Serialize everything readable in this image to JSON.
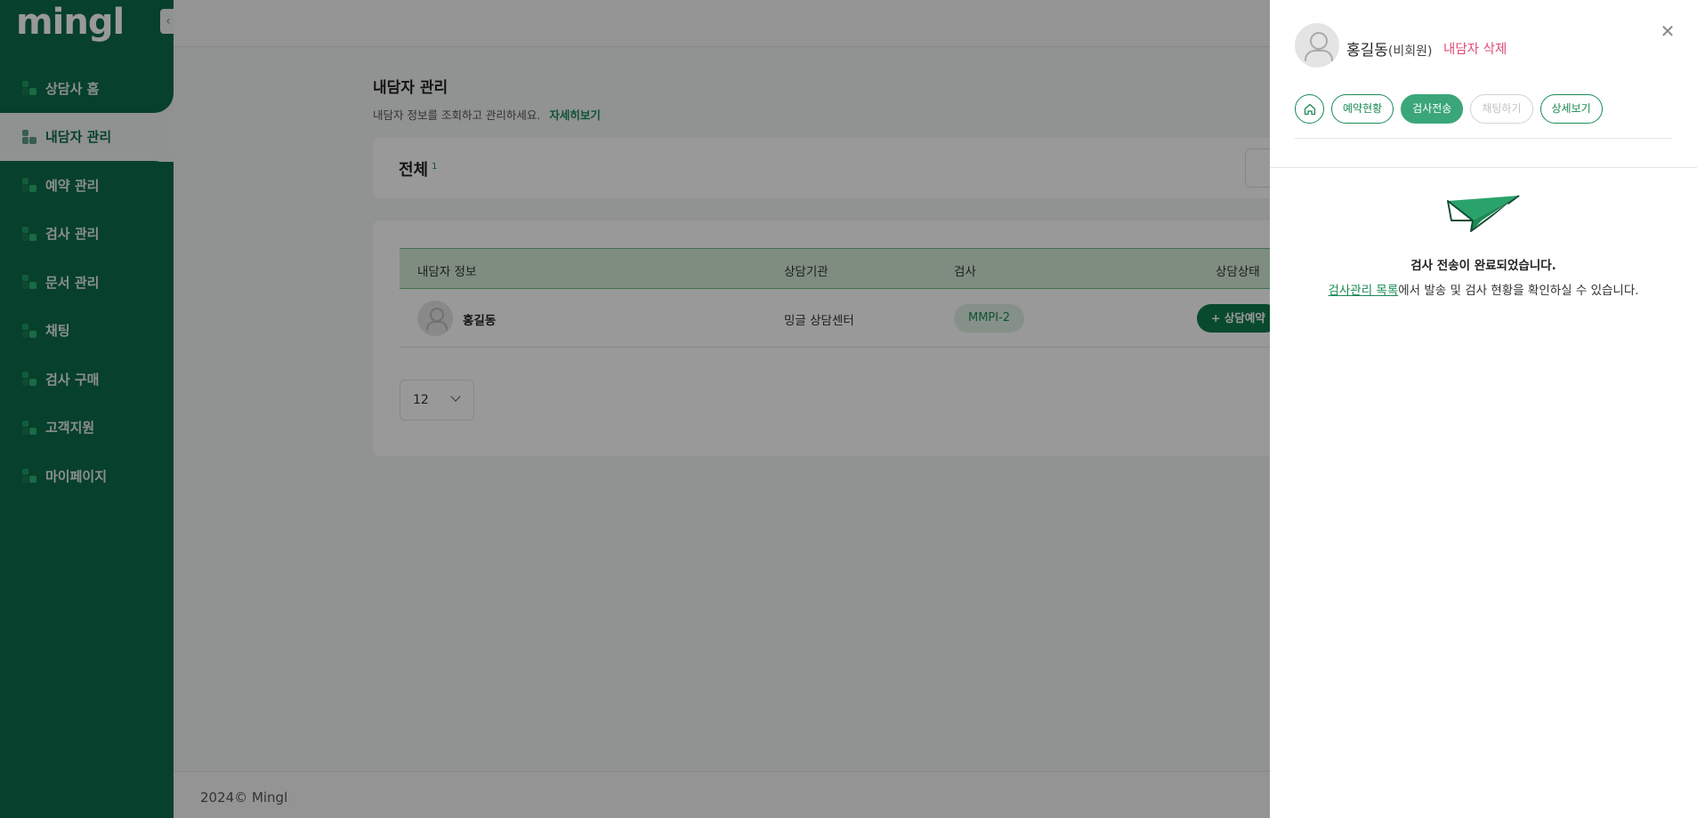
{
  "app": {
    "logo": "mingl"
  },
  "sidebar": {
    "collapse_icon": "chevron-left-icon",
    "items": [
      {
        "label": "상담사 홈",
        "icon": "home-grid-icon"
      },
      {
        "label": "내담자 관리",
        "icon": "client-list-icon",
        "active": true
      },
      {
        "label": "예약 관리",
        "icon": "calendar-icon"
      },
      {
        "label": "검사 관리",
        "icon": "test-icon"
      },
      {
        "label": "문서 관리",
        "icon": "document-icon"
      },
      {
        "label": "채팅",
        "icon": "chat-icon"
      },
      {
        "label": "검사 구매",
        "icon": "cart-icon"
      },
      {
        "label": "고객지원",
        "icon": "support-icon"
      },
      {
        "label": "마이페이지",
        "icon": "user-icon"
      }
    ]
  },
  "page": {
    "title": "내담자 관리",
    "desc": "내담자 정보를 조회하고 관리하세요.",
    "more_link": "자세히보기",
    "total_label": "전체",
    "total_count": "1"
  },
  "table": {
    "headers": [
      "내담자 정보",
      "상담기관",
      "검사",
      "상담상태"
    ],
    "rows": [
      {
        "name": "홍길동",
        "org": "밍글 상담센터",
        "test": "MMPI-2",
        "action": "+ 상담예약"
      }
    ]
  },
  "pagination": {
    "page_size": "12"
  },
  "footer": {
    "copyright": "2024© Mingl"
  },
  "drawer": {
    "name": "홍길동",
    "member_type": "(비회원)",
    "delete_label": "내담자 삭제",
    "close_icon": "close-icon",
    "tabs": [
      {
        "label": "예약현황",
        "state": "normal"
      },
      {
        "label": "검사전송",
        "state": "active"
      },
      {
        "label": "채팅하기",
        "state": "disabled"
      },
      {
        "label": "상세보기",
        "state": "normal"
      }
    ],
    "success_title": "검사 전송이 완료되었습니다.",
    "success_link": "검사관리 목록",
    "success_rest": "에서 발송 및 검사 현황을 확인하실 수 있습니다.",
    "colors": {
      "accent": "#1b8a55",
      "danger": "#e04b73",
      "sidebar": "#0c6b4a"
    }
  }
}
